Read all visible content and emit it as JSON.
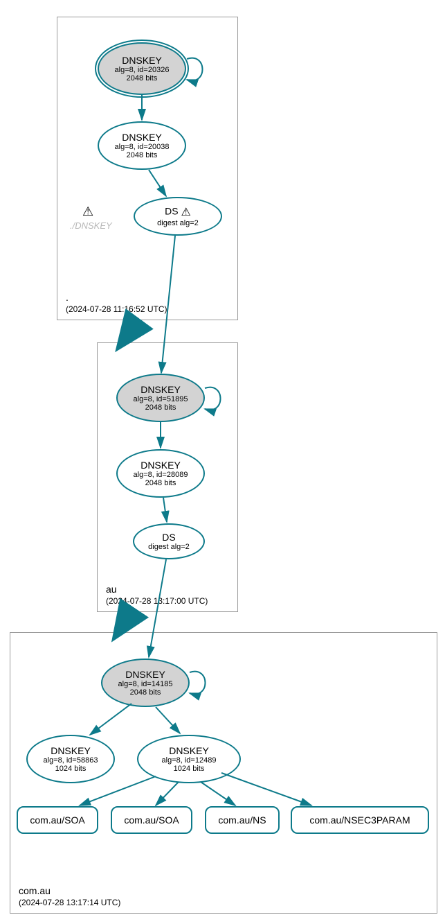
{
  "zones": {
    "root": {
      "name": ".",
      "timestamp": "(2024-07-28 11:16:52 UTC)",
      "ksk": {
        "title": "DNSKEY",
        "sub1": "alg=8, id=20326",
        "sub2": "2048 bits"
      },
      "zsk": {
        "title": "DNSKEY",
        "sub1": "alg=8, id=20038",
        "sub2": "2048 bits"
      },
      "ds": {
        "title": "DS",
        "sub1": "digest alg=2",
        "warn": "⚠"
      },
      "ghost": {
        "warn": "⚠",
        "label": "./DNSKEY"
      }
    },
    "au": {
      "name": "au",
      "timestamp": "(2024-07-28 13:17:00 UTC)",
      "ksk": {
        "title": "DNSKEY",
        "sub1": "alg=8, id=51895",
        "sub2": "2048 bits"
      },
      "zsk": {
        "title": "DNSKEY",
        "sub1": "alg=8, id=28089",
        "sub2": "2048 bits"
      },
      "ds": {
        "title": "DS",
        "sub1": "digest alg=2"
      }
    },
    "comau": {
      "name": "com.au",
      "timestamp": "(2024-07-28 13:17:14 UTC)",
      "ksk": {
        "title": "DNSKEY",
        "sub1": "alg=8, id=14185",
        "sub2": "2048 bits"
      },
      "zsk1": {
        "title": "DNSKEY",
        "sub1": "alg=8, id=58863",
        "sub2": "1024 bits"
      },
      "zsk2": {
        "title": "DNSKEY",
        "sub1": "alg=8, id=12489",
        "sub2": "1024 bits"
      },
      "rr1": "com.au/SOA",
      "rr2": "com.au/SOA",
      "rr3": "com.au/NS",
      "rr4": "com.au/NSEC3PARAM"
    }
  },
  "colors": {
    "stroke": "#0d7a8a",
    "ksk_fill": "#d3d3d3"
  }
}
